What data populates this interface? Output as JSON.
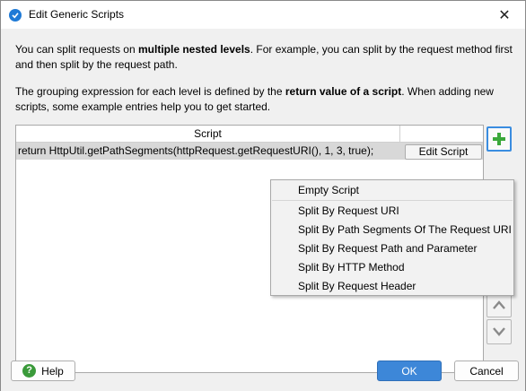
{
  "window": {
    "title": "Edit Generic Scripts",
    "close_glyph": "✕"
  },
  "info": {
    "p1_a": "You can split requests on ",
    "p1_b": "multiple nested levels",
    "p1_c": ". For example, you can split by the request method first and then split by the request path.",
    "p2_a": "The grouping expression for each level is defined by the ",
    "p2_b": "return value of a script",
    "p2_c": ". When adding new scripts, some example entries help you to get started."
  },
  "table": {
    "column_script": "Script",
    "rows": [
      {
        "script": "return HttpUtil.getPathSegments(httpRequest.getRequestURI(), 1, 3, true);",
        "action": "Edit Script"
      }
    ]
  },
  "menu": {
    "items": [
      "Empty Script",
      "Split By Request URI",
      "Split By Path Segments Of The Request URI",
      "Split By Request Path and Parameter",
      "Split By HTTP Method",
      "Split By Request Header"
    ]
  },
  "icons": {
    "add": "plus-icon",
    "up": "arrow-up-icon",
    "down": "arrow-down-icon",
    "help": "help-icon",
    "app": "app-icon"
  },
  "buttons": {
    "help": "Help",
    "ok": "OK",
    "cancel": "Cancel"
  },
  "colors": {
    "accent": "#3d87d8",
    "add_green": "#3aa83a"
  }
}
